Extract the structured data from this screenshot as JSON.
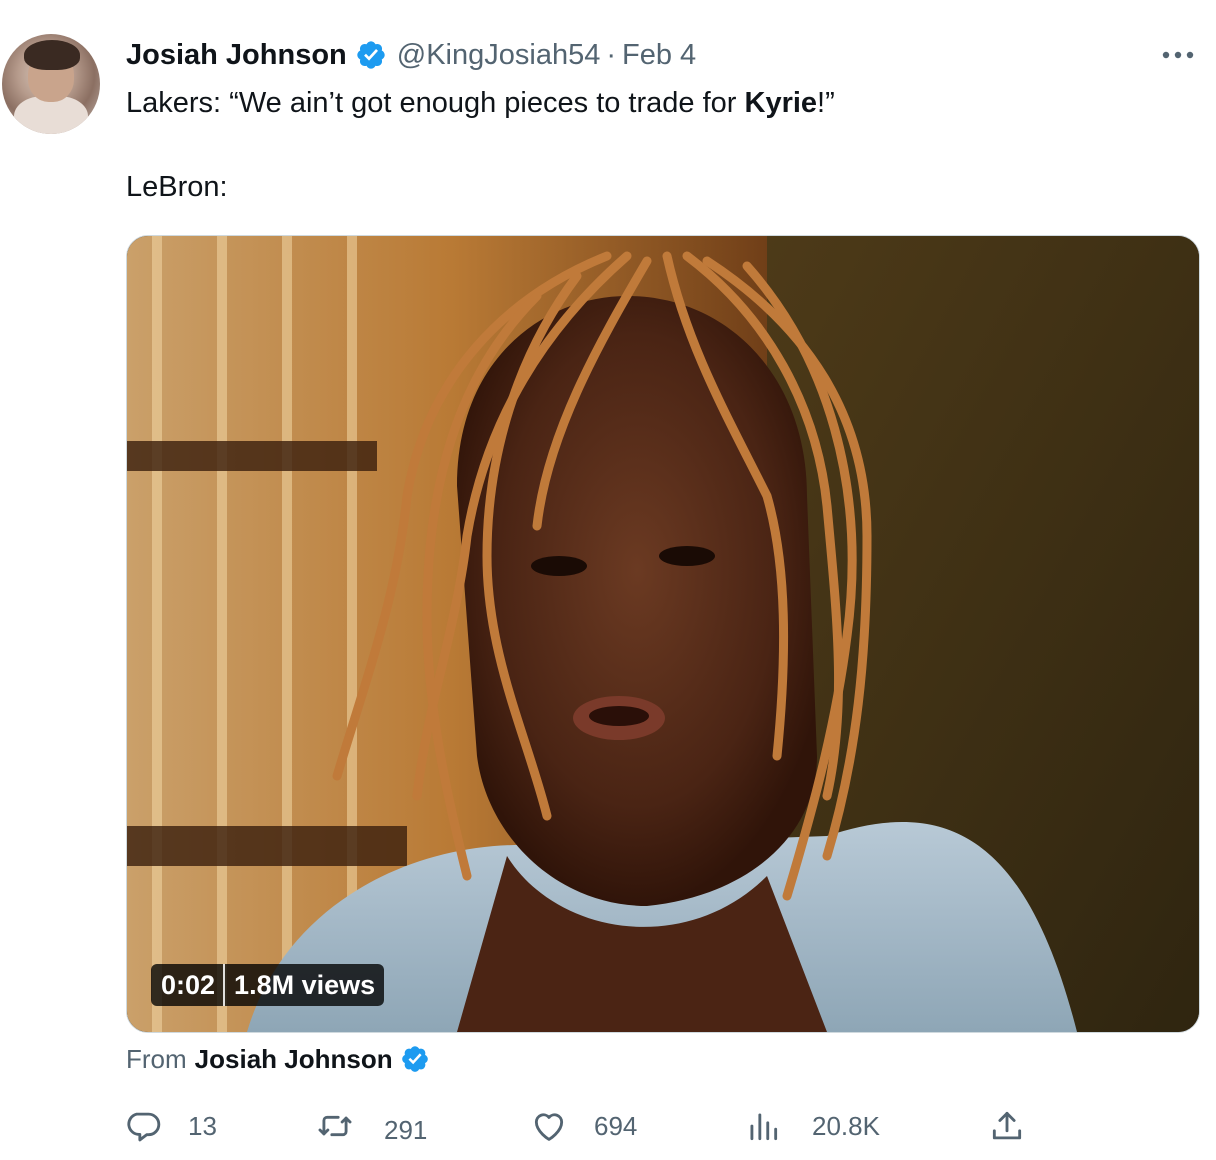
{
  "tweet": {
    "author": {
      "display_name": "Josiah Johnson",
      "handle": "@KingJosiah54",
      "verified": true
    },
    "separator": "·",
    "date": "Feb 4",
    "more_icon": "more-horizontal-icon",
    "text": {
      "prefix": "Lakers: “We ain’t got enough pieces to trade for ",
      "bold": "Kyrie",
      "suffix": "!”",
      "line2": "LeBron:"
    },
    "media": {
      "type": "video",
      "time": "0:02",
      "views": "1.8M views"
    },
    "from": {
      "label": "From",
      "name": "Josiah Johnson"
    },
    "actions": {
      "reply": "13",
      "retweet": "291",
      "like": "694",
      "views": "20.8K"
    }
  },
  "colors": {
    "verified": "#1d9bf0",
    "text": "#0f1419",
    "secondary": "#536471"
  }
}
